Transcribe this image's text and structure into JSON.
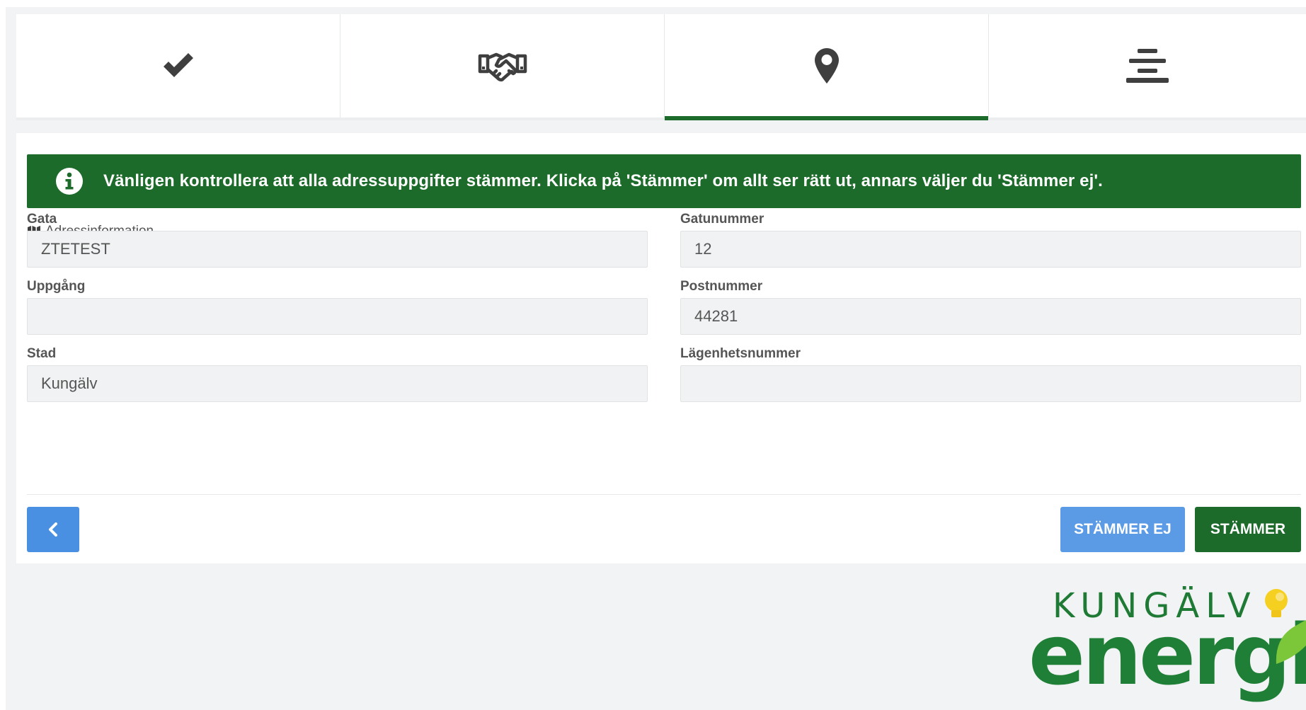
{
  "steps": [
    {
      "icon": "check-icon",
      "active": false
    },
    {
      "icon": "handshake-icon",
      "active": false
    },
    {
      "icon": "map-marker-icon",
      "active": true
    },
    {
      "icon": "align-center-icon",
      "active": false
    }
  ],
  "alert": {
    "icon": "info-circle-icon",
    "text": "Vänligen kontrollera att alla adressuppgifter stämmer. Klicka på 'Stämmer' om allt ser rätt ut, annars väljer du 'Stämmer ej'."
  },
  "section": {
    "icon": "map-icon",
    "title": "Adressinformation"
  },
  "fields": {
    "gata": {
      "label": "Gata",
      "value": "ZTETEST"
    },
    "gatunummer": {
      "label": "Gatunummer",
      "value": "12"
    },
    "uppgang": {
      "label": "Uppgång",
      "value": ""
    },
    "postnummer": {
      "label": "Postnummer",
      "value": "44281"
    },
    "stad": {
      "label": "Stad",
      "value": "Kungälv"
    },
    "lagenhetsnummer": {
      "label": "Lägenhetsnummer",
      "value": ""
    }
  },
  "buttons": {
    "back_icon": "chevron-left-icon",
    "no": "STÄMMER EJ",
    "yes": "STÄMMER"
  },
  "logo": {
    "top": "KUNGÄLV",
    "main": "energi"
  },
  "colors": {
    "primary_green": "#1d6b2b",
    "blue": "#4a90e2",
    "light_blue": "#5b9be6",
    "logo_green": "#1f7f36",
    "logo_yellow": "#f5d020"
  }
}
